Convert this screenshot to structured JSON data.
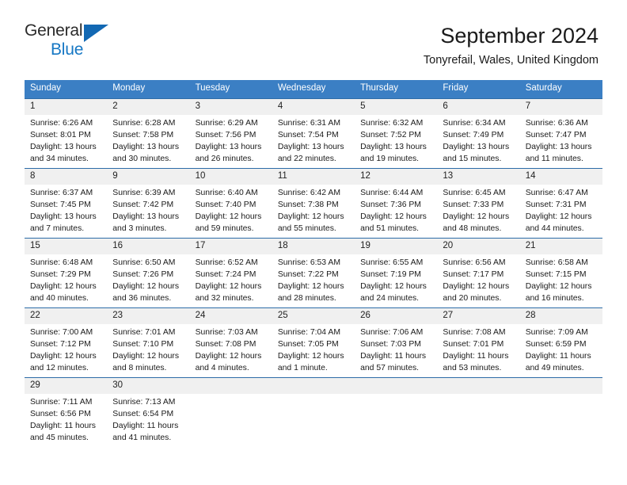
{
  "brand": {
    "name_part1": "General",
    "name_part2": "Blue",
    "triangle_color": "#1268b3",
    "blue_text_color": "#1577c4"
  },
  "header": {
    "title": "September 2024",
    "subtitle": "Tonyrefail, Wales, United Kingdom"
  },
  "theme": {
    "header_bg": "#3b7fc4",
    "cell_border": "#2d6ca8",
    "daynum_bg": "#f0f0f0"
  },
  "weekdays": [
    "Sunday",
    "Monday",
    "Tuesday",
    "Wednesday",
    "Thursday",
    "Friday",
    "Saturday"
  ],
  "days": [
    {
      "num": "1",
      "sunrise": "Sunrise: 6:26 AM",
      "sunset": "Sunset: 8:01 PM",
      "daylight1": "Daylight: 13 hours",
      "daylight2": "and 34 minutes."
    },
    {
      "num": "2",
      "sunrise": "Sunrise: 6:28 AM",
      "sunset": "Sunset: 7:58 PM",
      "daylight1": "Daylight: 13 hours",
      "daylight2": "and 30 minutes."
    },
    {
      "num": "3",
      "sunrise": "Sunrise: 6:29 AM",
      "sunset": "Sunset: 7:56 PM",
      "daylight1": "Daylight: 13 hours",
      "daylight2": "and 26 minutes."
    },
    {
      "num": "4",
      "sunrise": "Sunrise: 6:31 AM",
      "sunset": "Sunset: 7:54 PM",
      "daylight1": "Daylight: 13 hours",
      "daylight2": "and 22 minutes."
    },
    {
      "num": "5",
      "sunrise": "Sunrise: 6:32 AM",
      "sunset": "Sunset: 7:52 PM",
      "daylight1": "Daylight: 13 hours",
      "daylight2": "and 19 minutes."
    },
    {
      "num": "6",
      "sunrise": "Sunrise: 6:34 AM",
      "sunset": "Sunset: 7:49 PM",
      "daylight1": "Daylight: 13 hours",
      "daylight2": "and 15 minutes."
    },
    {
      "num": "7",
      "sunrise": "Sunrise: 6:36 AM",
      "sunset": "Sunset: 7:47 PM",
      "daylight1": "Daylight: 13 hours",
      "daylight2": "and 11 minutes."
    },
    {
      "num": "8",
      "sunrise": "Sunrise: 6:37 AM",
      "sunset": "Sunset: 7:45 PM",
      "daylight1": "Daylight: 13 hours",
      "daylight2": "and 7 minutes."
    },
    {
      "num": "9",
      "sunrise": "Sunrise: 6:39 AM",
      "sunset": "Sunset: 7:42 PM",
      "daylight1": "Daylight: 13 hours",
      "daylight2": "and 3 minutes."
    },
    {
      "num": "10",
      "sunrise": "Sunrise: 6:40 AM",
      "sunset": "Sunset: 7:40 PM",
      "daylight1": "Daylight: 12 hours",
      "daylight2": "and 59 minutes."
    },
    {
      "num": "11",
      "sunrise": "Sunrise: 6:42 AM",
      "sunset": "Sunset: 7:38 PM",
      "daylight1": "Daylight: 12 hours",
      "daylight2": "and 55 minutes."
    },
    {
      "num": "12",
      "sunrise": "Sunrise: 6:44 AM",
      "sunset": "Sunset: 7:36 PM",
      "daylight1": "Daylight: 12 hours",
      "daylight2": "and 51 minutes."
    },
    {
      "num": "13",
      "sunrise": "Sunrise: 6:45 AM",
      "sunset": "Sunset: 7:33 PM",
      "daylight1": "Daylight: 12 hours",
      "daylight2": "and 48 minutes."
    },
    {
      "num": "14",
      "sunrise": "Sunrise: 6:47 AM",
      "sunset": "Sunset: 7:31 PM",
      "daylight1": "Daylight: 12 hours",
      "daylight2": "and 44 minutes."
    },
    {
      "num": "15",
      "sunrise": "Sunrise: 6:48 AM",
      "sunset": "Sunset: 7:29 PM",
      "daylight1": "Daylight: 12 hours",
      "daylight2": "and 40 minutes."
    },
    {
      "num": "16",
      "sunrise": "Sunrise: 6:50 AM",
      "sunset": "Sunset: 7:26 PM",
      "daylight1": "Daylight: 12 hours",
      "daylight2": "and 36 minutes."
    },
    {
      "num": "17",
      "sunrise": "Sunrise: 6:52 AM",
      "sunset": "Sunset: 7:24 PM",
      "daylight1": "Daylight: 12 hours",
      "daylight2": "and 32 minutes."
    },
    {
      "num": "18",
      "sunrise": "Sunrise: 6:53 AM",
      "sunset": "Sunset: 7:22 PM",
      "daylight1": "Daylight: 12 hours",
      "daylight2": "and 28 minutes."
    },
    {
      "num": "19",
      "sunrise": "Sunrise: 6:55 AM",
      "sunset": "Sunset: 7:19 PM",
      "daylight1": "Daylight: 12 hours",
      "daylight2": "and 24 minutes."
    },
    {
      "num": "20",
      "sunrise": "Sunrise: 6:56 AM",
      "sunset": "Sunset: 7:17 PM",
      "daylight1": "Daylight: 12 hours",
      "daylight2": "and 20 minutes."
    },
    {
      "num": "21",
      "sunrise": "Sunrise: 6:58 AM",
      "sunset": "Sunset: 7:15 PM",
      "daylight1": "Daylight: 12 hours",
      "daylight2": "and 16 minutes."
    },
    {
      "num": "22",
      "sunrise": "Sunrise: 7:00 AM",
      "sunset": "Sunset: 7:12 PM",
      "daylight1": "Daylight: 12 hours",
      "daylight2": "and 12 minutes."
    },
    {
      "num": "23",
      "sunrise": "Sunrise: 7:01 AM",
      "sunset": "Sunset: 7:10 PM",
      "daylight1": "Daylight: 12 hours",
      "daylight2": "and 8 minutes."
    },
    {
      "num": "24",
      "sunrise": "Sunrise: 7:03 AM",
      "sunset": "Sunset: 7:08 PM",
      "daylight1": "Daylight: 12 hours",
      "daylight2": "and 4 minutes."
    },
    {
      "num": "25",
      "sunrise": "Sunrise: 7:04 AM",
      "sunset": "Sunset: 7:05 PM",
      "daylight1": "Daylight: 12 hours",
      "daylight2": "and 1 minute."
    },
    {
      "num": "26",
      "sunrise": "Sunrise: 7:06 AM",
      "sunset": "Sunset: 7:03 PM",
      "daylight1": "Daylight: 11 hours",
      "daylight2": "and 57 minutes."
    },
    {
      "num": "27",
      "sunrise": "Sunrise: 7:08 AM",
      "sunset": "Sunset: 7:01 PM",
      "daylight1": "Daylight: 11 hours",
      "daylight2": "and 53 minutes."
    },
    {
      "num": "28",
      "sunrise": "Sunrise: 7:09 AM",
      "sunset": "Sunset: 6:59 PM",
      "daylight1": "Daylight: 11 hours",
      "daylight2": "and 49 minutes."
    },
    {
      "num": "29",
      "sunrise": "Sunrise: 7:11 AM",
      "sunset": "Sunset: 6:56 PM",
      "daylight1": "Daylight: 11 hours",
      "daylight2": "and 45 minutes."
    },
    {
      "num": "30",
      "sunrise": "Sunrise: 7:13 AM",
      "sunset": "Sunset: 6:54 PM",
      "daylight1": "Daylight: 11 hours",
      "daylight2": "and 41 minutes."
    }
  ]
}
